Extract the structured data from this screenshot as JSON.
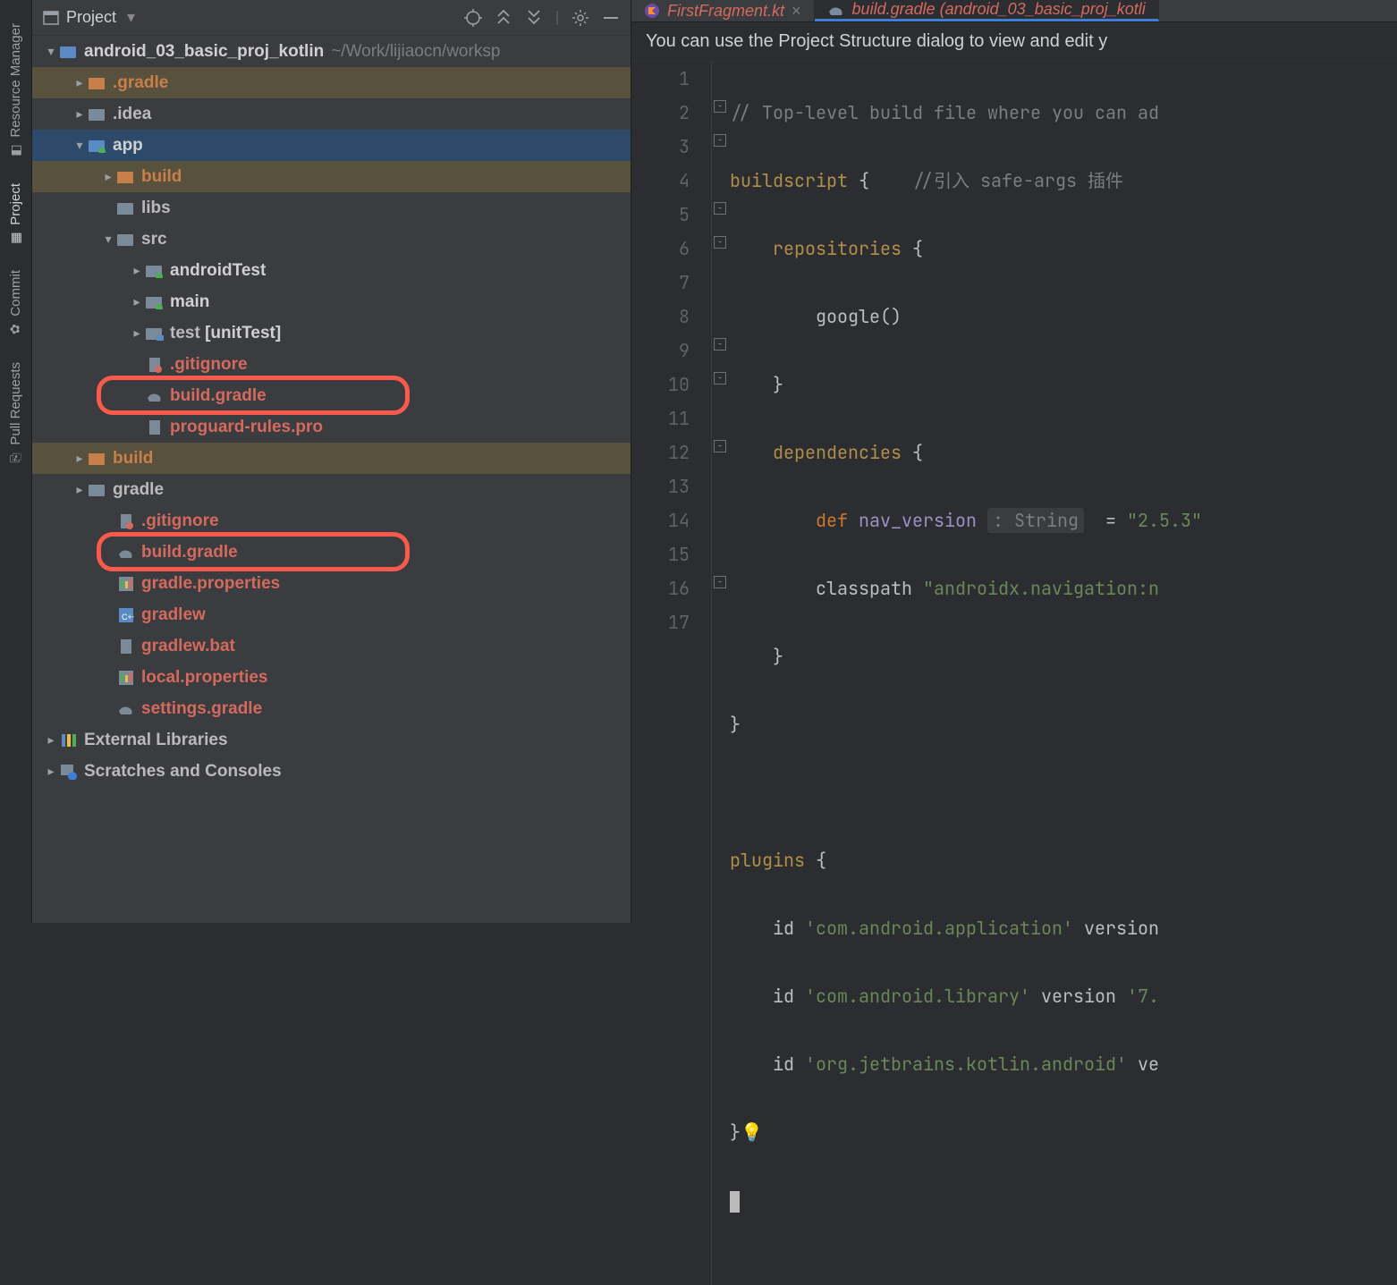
{
  "rail": {
    "resource_manager": "Resource Manager",
    "project": "Project",
    "commit": "Commit",
    "pull_requests": "Pull Requests"
  },
  "panel": {
    "title": "Project"
  },
  "tree": {
    "root": "android_03_basic_proj_kotlin",
    "root_path": "~/Work/lijiaocn/worksp",
    "gradle_dir": ".gradle",
    "idea_dir": ".idea",
    "app": "app",
    "build": "build",
    "libs": "libs",
    "src": "src",
    "androidTest": "androidTest",
    "main": "main",
    "test": "test",
    "test_suffix": "[unitTest]",
    "gitignore": ".gitignore",
    "build_gradle": "build.gradle",
    "proguard": "proguard-rules.pro",
    "root_build": "build",
    "root_gradle": "gradle",
    "root_gitignore": ".gitignore",
    "root_build_gradle": "build.gradle",
    "gradle_props": "gradle.properties",
    "gradlew": "gradlew",
    "gradlew_bat": "gradlew.bat",
    "local_props": "local.properties",
    "settings_gradle": "settings.gradle",
    "ext_libs": "External Libraries",
    "scratches": "Scratches and Consoles"
  },
  "tabs": {
    "tab1": "FirstFragment.kt",
    "tab2": "build.gradle (android_03_basic_proj_kotli"
  },
  "hint": "You can use the Project Structure dialog to view and edit y",
  "code": {
    "lines": [
      "1",
      "2",
      "3",
      "4",
      "5",
      "6",
      "7",
      "8",
      "9",
      "10",
      "11",
      "12",
      "13",
      "14",
      "15",
      "16",
      "17"
    ],
    "l1": "// Top-level build file where you can ad",
    "l2_a": "buildscript",
    "l2_b": " {    ",
    "l2_c": "//引入 safe-args 插件",
    "l3_a": "    repositories",
    "l3_b": " {",
    "l4": "        google()",
    "l5": "    }",
    "l6_a": "    dependencies",
    "l6_b": " {",
    "l7_a": "        ",
    "l7_def": "def",
    "l7_b": " nav_version ",
    "l7_type": ": String",
    "l7_c": "  = ",
    "l7_str": "\"2.5.3\"",
    "l8_a": "        classpath ",
    "l8_str": "\"androidx.navigation:n",
    "l9": "    }",
    "l10": "}",
    "l12_a": "plugins",
    "l12_b": " {",
    "l13_a": "    id ",
    "l13_str": "'com.android.application'",
    "l13_b": " version",
    "l14_a": "    id ",
    "l14_str": "'com.android.library'",
    "l14_b": " version ",
    "l14_c": "'7.",
    "l15_a": "    id ",
    "l15_str": "'org.jetbrains.kotlin.android'",
    "l15_b": " ve",
    "l16": "}"
  }
}
